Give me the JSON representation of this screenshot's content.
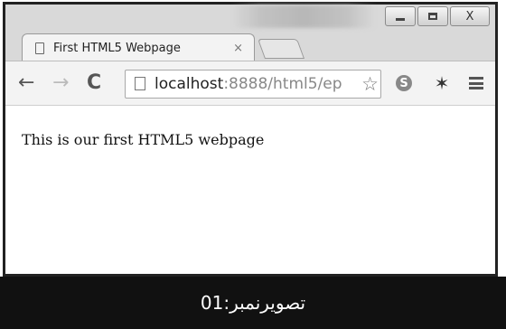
{
  "browser": {
    "tab": {
      "title": "First HTML5 Webpage",
      "close_glyph": "×"
    },
    "window_buttons": {
      "minimize": "minimize-icon",
      "maximize": "maximize-icon",
      "close": "X"
    },
    "toolbar": {
      "back": "←",
      "forward": "→",
      "reload": "C",
      "url_host": "localhost",
      "url_rest": ":8888/html5/ep",
      "bookmark_star": "☆",
      "extensions": [
        {
          "name": "skype-icon",
          "glyph": "S"
        },
        {
          "name": "bug-icon",
          "glyph": "✶"
        }
      ],
      "menu": "menu-icon"
    },
    "page": {
      "text": "This is our first HTML5 webpage"
    }
  },
  "caption": {
    "text": "تصویرنمبر:01"
  },
  "colors": {
    "caption_bg": "#111111",
    "frame": "#d9d9d9"
  }
}
